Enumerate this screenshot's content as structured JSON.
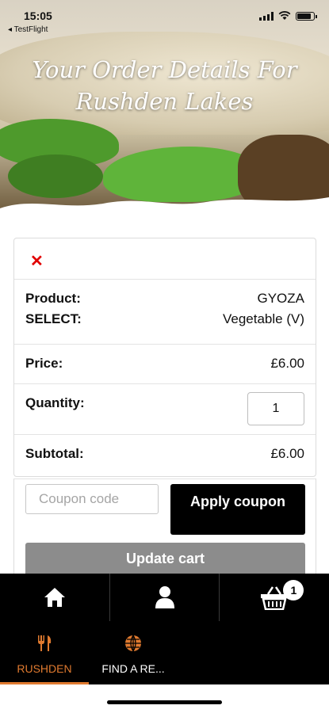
{
  "status_bar": {
    "time": "15:05",
    "back_label": "◂ TestFlight"
  },
  "hero": {
    "title": "Your Order Details For Rushden Lakes"
  },
  "cart": {
    "remove_symbol": "✕",
    "product_label": "Product:",
    "product_value": "GYOZA",
    "select_label": "SELECT:",
    "select_value": "Vegetable (V)",
    "price_label": "Price:",
    "price_value": "£6.00",
    "quantity_label": "Quantity:",
    "quantity_value": "1",
    "subtotal_label": "Subtotal:",
    "subtotal_value": "£6.00"
  },
  "coupon": {
    "placeholder": "Coupon code",
    "apply_label": "Apply coupon"
  },
  "update_cart_label": "Update cart",
  "icon_bar": {
    "cart_count": "1",
    "icons": [
      "home-icon",
      "user-icon",
      "basket-icon"
    ]
  },
  "tabs": [
    {
      "label": "RUSHDEN",
      "icon": "cutlery-icon",
      "active": true
    },
    {
      "label": "FIND A RE...",
      "icon": "globe-icon",
      "active": false
    }
  ],
  "colors": {
    "accent": "#e07a2f",
    "remove": "#e10000",
    "dark": "#000000",
    "update_bg": "#8c8c8c"
  }
}
